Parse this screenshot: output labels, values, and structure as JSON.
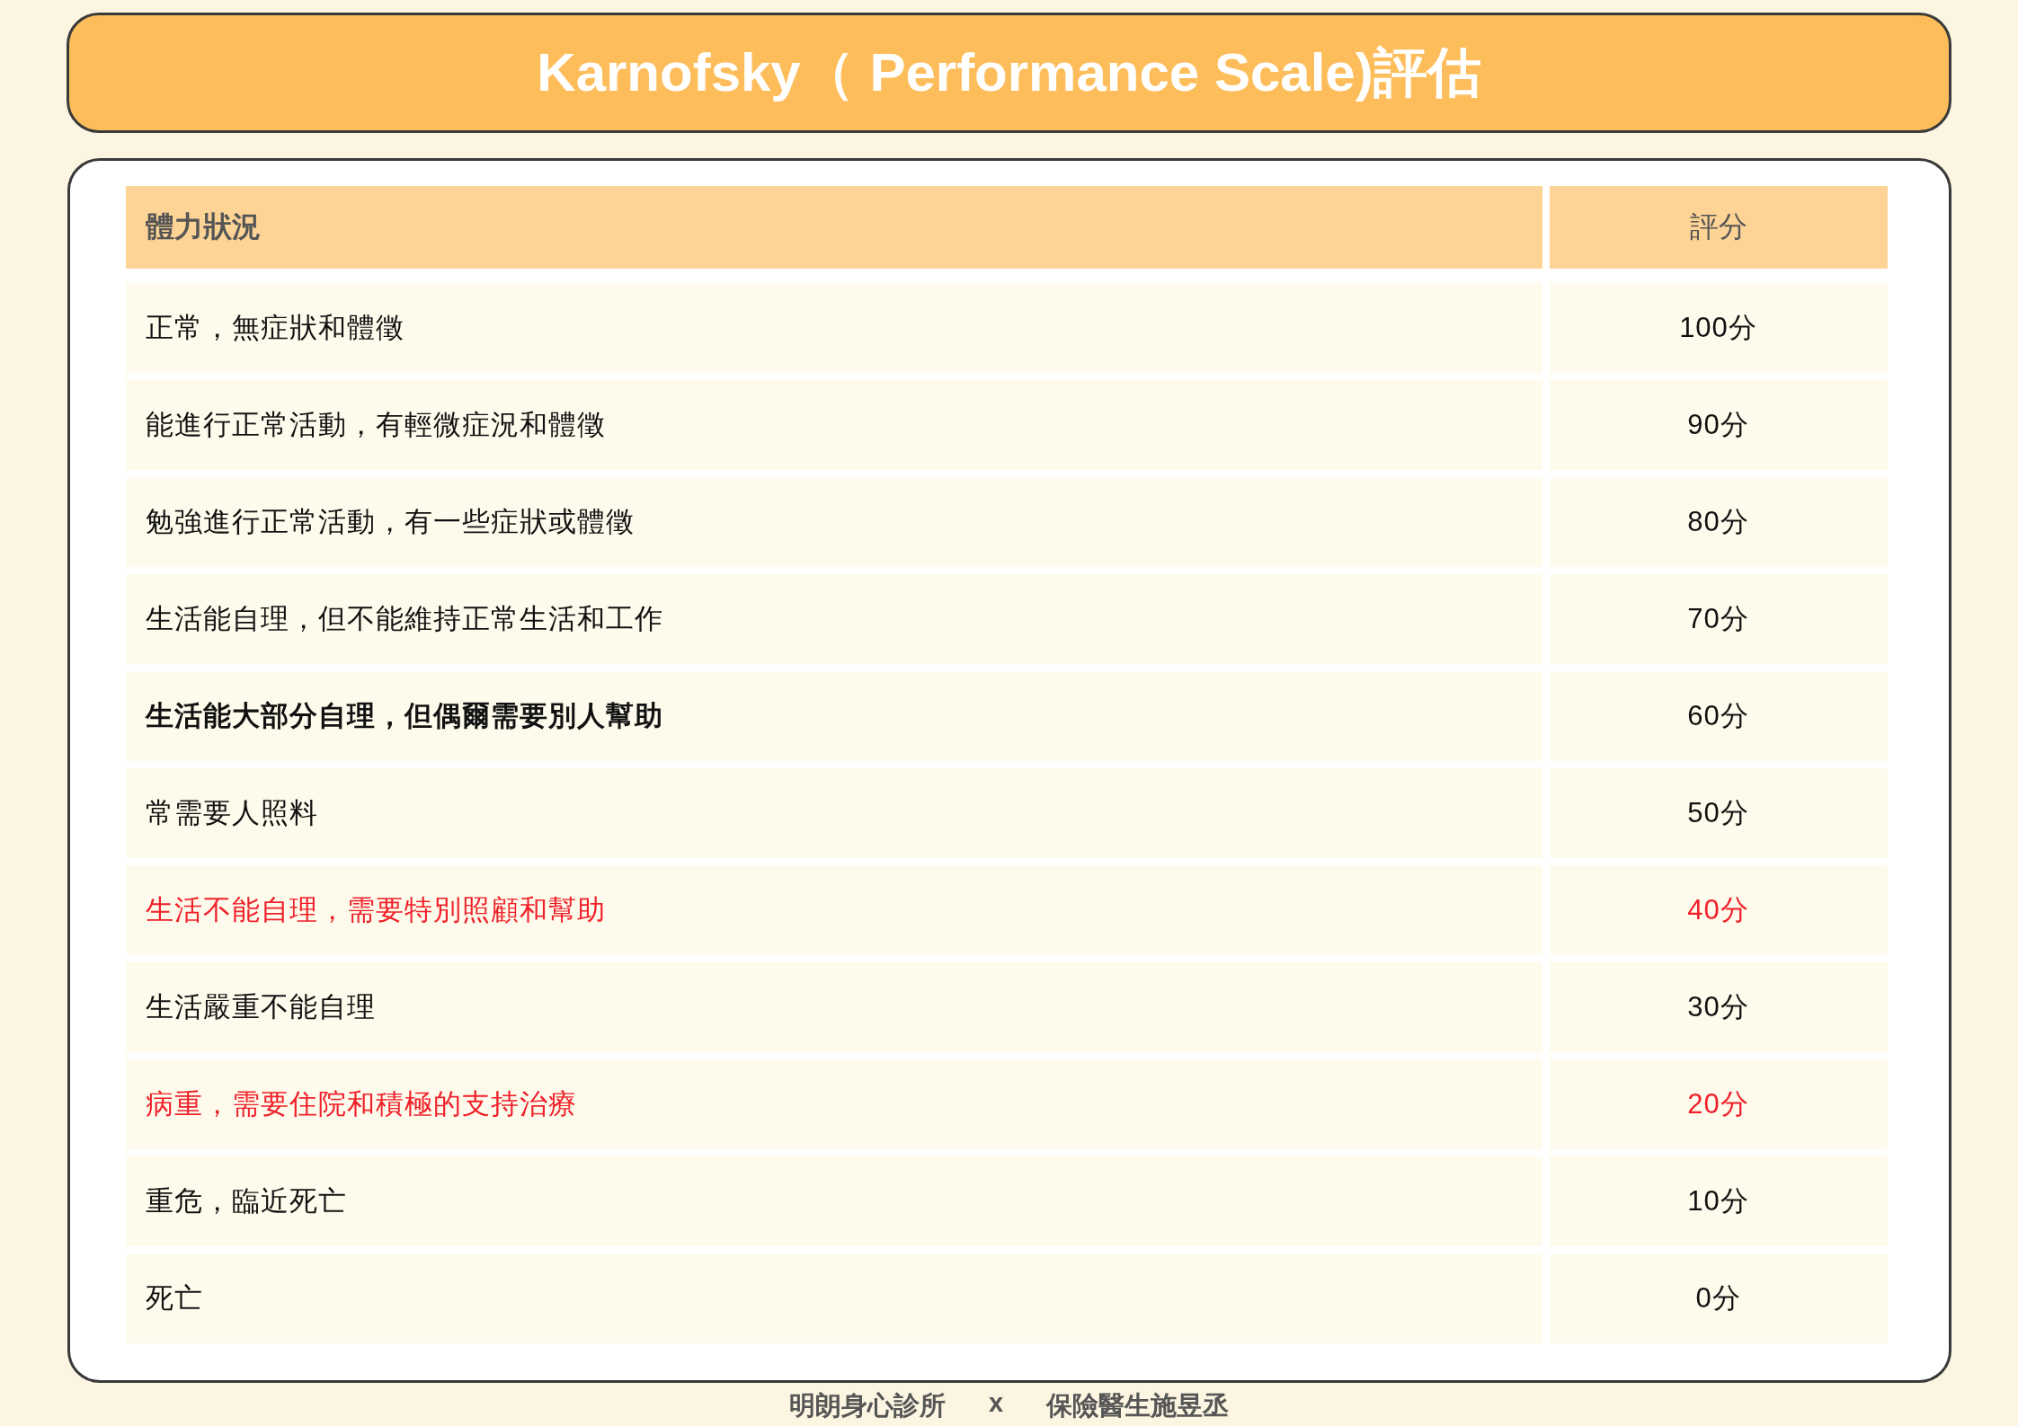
{
  "title": "Karnofsky（ Performance Scale)評估",
  "table": {
    "columns": [
      "體力狀況",
      "評分"
    ],
    "rows": [
      {
        "status": "正常，無症狀和體徵",
        "score": "100分",
        "kind": "normal"
      },
      {
        "status": "能進行正常活動，有輕微症況和體徵",
        "score": "90分",
        "kind": "normal"
      },
      {
        "status": "勉強進行正常活動，有一些症狀或體徵",
        "score": "80分",
        "kind": "normal"
      },
      {
        "status": "生活能自理，但不能維持正常生活和工作",
        "score": "70分",
        "kind": "normal"
      },
      {
        "status": "生活能大部分自理，但偶爾需要別人幫助",
        "score": "60分",
        "kind": "bold"
      },
      {
        "status": "常需要人照料",
        "score": "50分",
        "kind": "normal"
      },
      {
        "status": "生活不能自理，需要特別照顧和幫助",
        "score": "40分",
        "kind": "alert"
      },
      {
        "status": "生活嚴重不能自理",
        "score": "30分",
        "kind": "normal"
      },
      {
        "status": "病重，需要住院和積極的支持治療",
        "score": "20分",
        "kind": "alert"
      },
      {
        "status": "重危，臨近死亡",
        "score": "10分",
        "kind": "normal"
      },
      {
        "status": "死亡",
        "score": "0分",
        "kind": "normal"
      }
    ]
  },
  "footer": [
    "明朗身心診所",
    "x",
    "保險醫生施昱丞"
  ]
}
